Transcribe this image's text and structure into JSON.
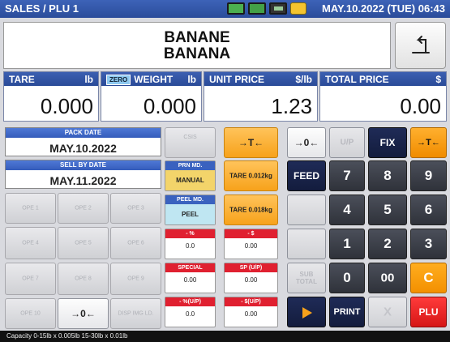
{
  "header": {
    "title": "SALES / PLU 1",
    "datetime": "MAY.10.2022 (TUE) 06:43",
    "status_icons": [
      "green-display-icon",
      "green-display-icon",
      "battery-icon",
      "plug-icon"
    ]
  },
  "item": {
    "name_line1": "BANANE",
    "name_line2": "BANANA"
  },
  "display": {
    "tare": {
      "label": "TARE",
      "unit": "lb",
      "value": "0.000"
    },
    "weight": {
      "badge": "ZERO",
      "label": "WEIGHT",
      "unit": "lb",
      "value": "0.000"
    },
    "unit_price": {
      "label": "UNIT PRICE",
      "unit": "$/lb",
      "value": "1.23"
    },
    "total_price": {
      "label": "TOTAL PRICE",
      "unit": "$",
      "value": "0.00"
    }
  },
  "dates": {
    "pack_label": "PACK DATE",
    "pack_value": "MAY.10.2022",
    "sell_label": "SELL BY DATE",
    "sell_value": "MAY.11.2022"
  },
  "ope": {
    "b1": "OPE 1",
    "b2": "OPE 2",
    "b3": "OPE 3",
    "b4": "OPE 4",
    "b5": "OPE 5",
    "b6": "OPE 6",
    "b7": "OPE 7",
    "b8": "OPE 8",
    "b9": "OPE 9",
    "b10": "OPE 10",
    "disp_img": "DISP IMG LD.",
    "csis": "CSIS"
  },
  "fields": {
    "prn_md_label": "PRN MD.",
    "prn_md_value": "MANUAL",
    "peel_md_label": "PEEL MD.",
    "peel_md_value": "PEEL",
    "pct_label": "- %",
    "pct_value": "0.0",
    "dollar_label": "- $",
    "dollar_value": "0.00",
    "special_label": "SPECIAL",
    "special_value": "0.00",
    "sp_label": "SP (U/P)",
    "sp_value": "0.00",
    "pct_up_label": "- %(U/P)",
    "pct_up_value": "0.0",
    "dollar_up_label": "- $(U/P)",
    "dollar_up_value": "0.00"
  },
  "tare_buttons": {
    "tare1": "TARE 0.012kg",
    "tare2": "TARE 0.018kg"
  },
  "keys": {
    "up": "U/P",
    "fix": "FIX",
    "feed": "FEED",
    "n7": "7",
    "n8": "8",
    "n9": "9",
    "n4": "4",
    "n5": "5",
    "n6": "6",
    "n1": "1",
    "n2": "2",
    "n3": "3",
    "sub": "SUB",
    "total": "TOTAL",
    "n0": "0",
    "n00": "00",
    "clear": "C",
    "print": "PRINT",
    "x": "X",
    "plu": "PLU"
  },
  "footer": {
    "text": "Capacity 0-15lb x 0.005lb  15-30lb x 0.01lb"
  }
}
